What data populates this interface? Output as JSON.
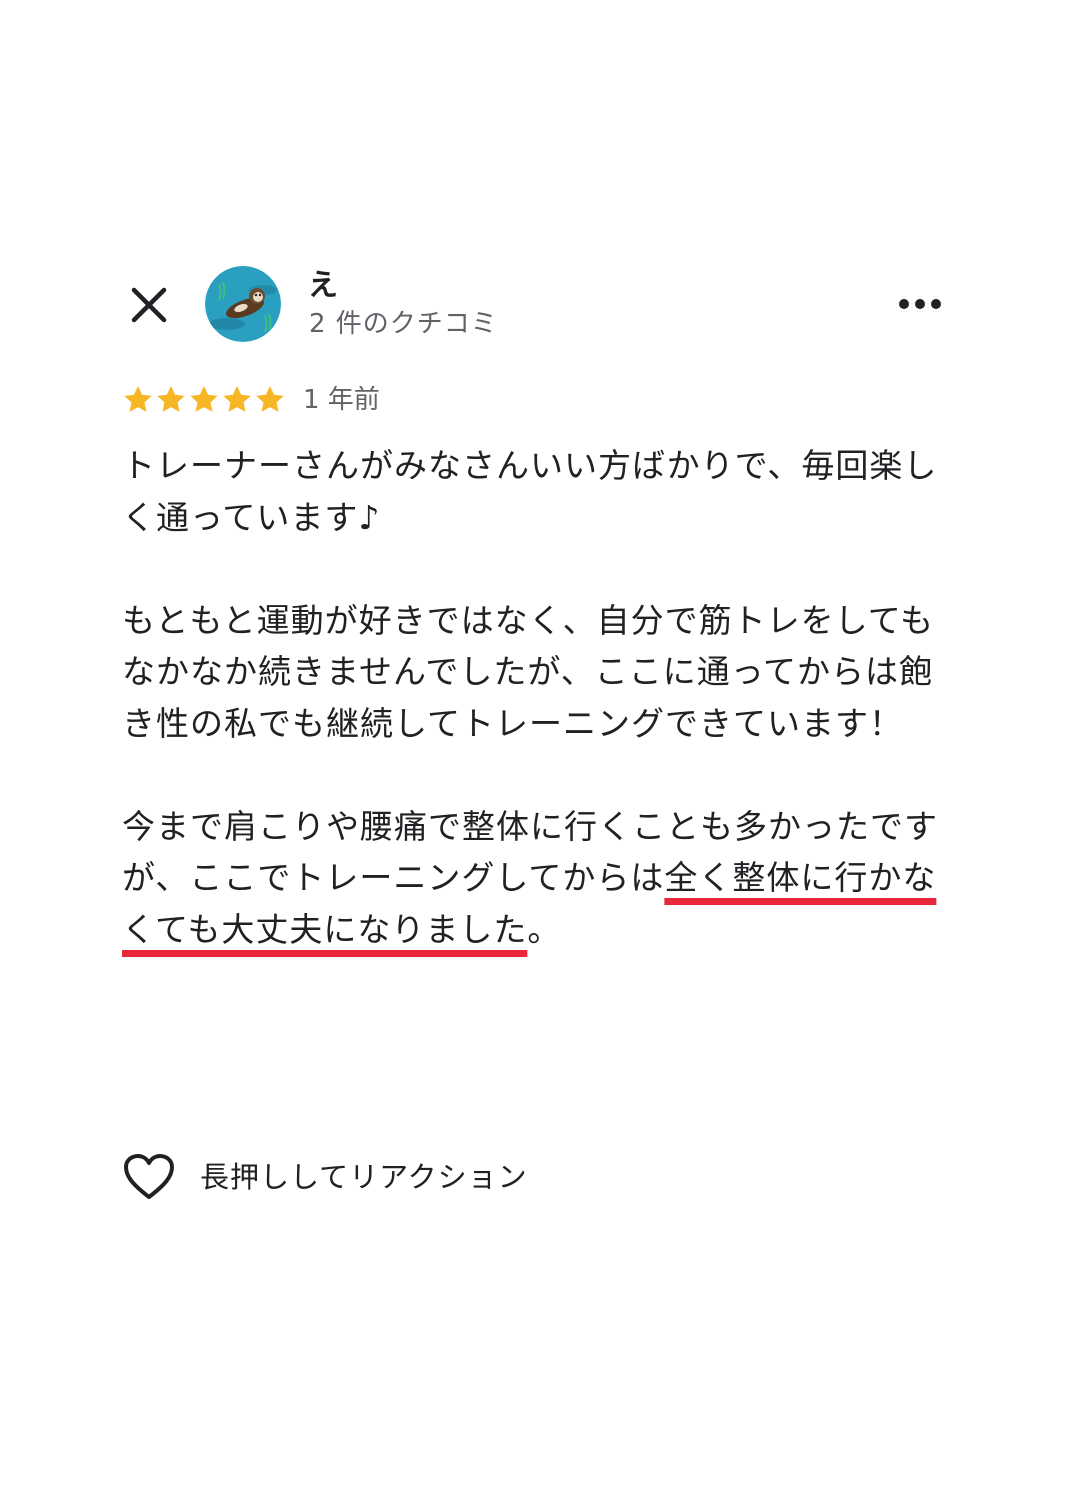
{
  "header": {
    "close_icon": "close-icon",
    "avatar_icon": "sea-otter-avatar",
    "author_name": "え",
    "review_count": "2 件のクチコミ",
    "more_icon": "more-horizontal-icon"
  },
  "rating": {
    "stars": 5,
    "max_stars": 5,
    "star_color": "#f6b626",
    "date": "1 年前"
  },
  "review": {
    "paragraph1": "トレーナーさんがみなさんいい方ばかりで、毎回楽しく通っています♪",
    "paragraph2": "もともと運動が好きではなく、自分で筋トレをしてもなかなか続きませんでしたが、ここに通ってからは飽き性の私でも継続してトレーニングできています！",
    "paragraph3_plain": "今まで肩こりや腰痛で整体に行くことも多かったですが、ここでトレーニングしてからは",
    "paragraph3_highlight": "全く整体に行かなくても大丈夫になりました",
    "paragraph3_end": "。",
    "highlight_color": "#e8283a"
  },
  "reaction": {
    "icon": "heart-outline-icon",
    "label": "長押ししてリアクション"
  }
}
